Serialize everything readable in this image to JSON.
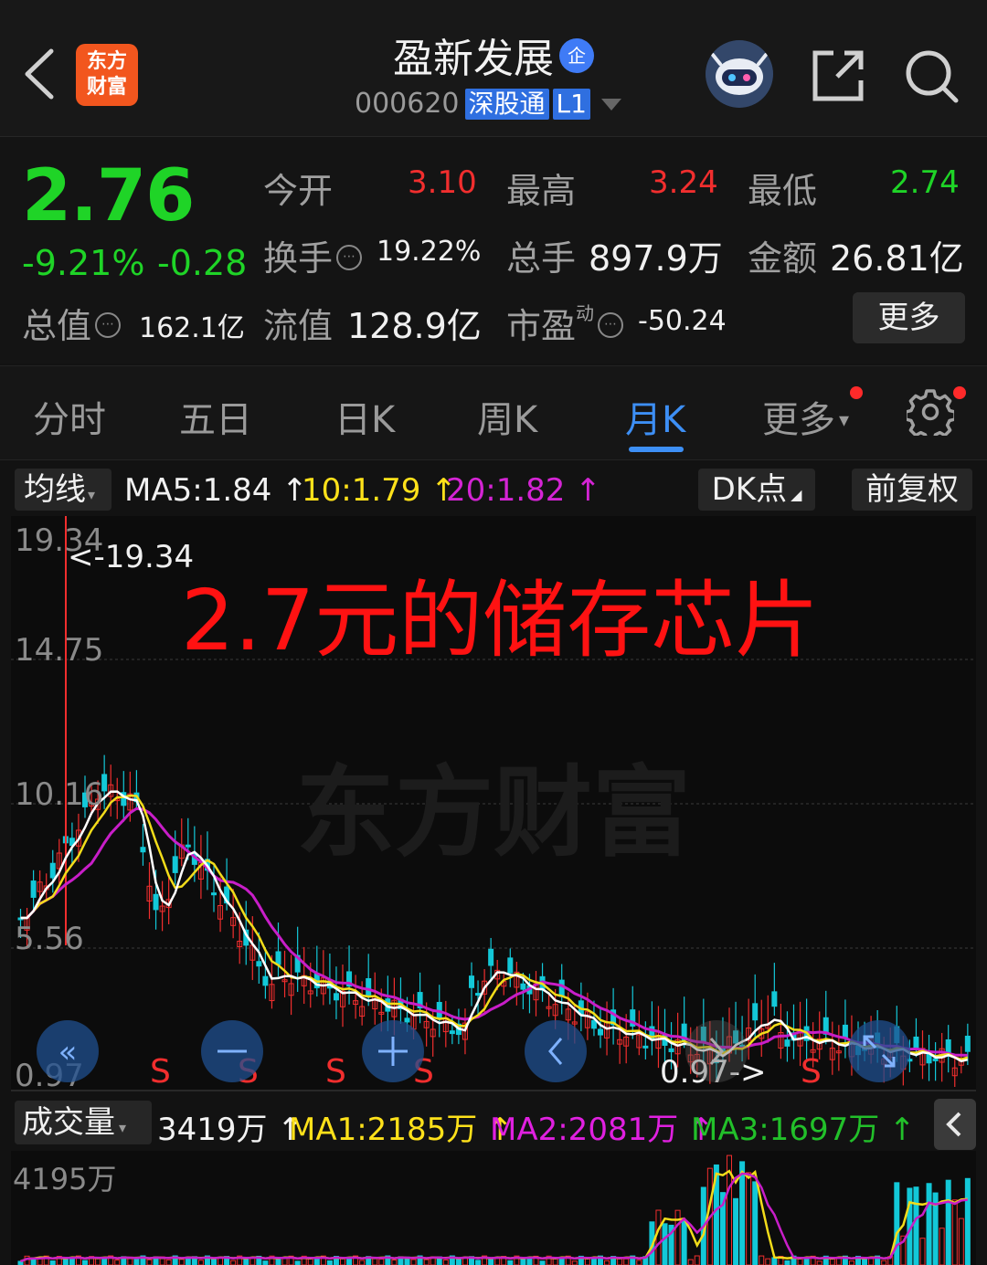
{
  "header": {
    "logo_text": "东方财富",
    "stock_name": "盈新发展",
    "stock_badge": "企",
    "code": "000620",
    "tags": [
      "深股通",
      "L1"
    ]
  },
  "quote": {
    "price": "2.76",
    "change_pct": "-9.21%",
    "change": "-0.28",
    "open_label": "今开",
    "open": "3.10",
    "high_label": "最高",
    "high": "3.24",
    "low_label": "最低",
    "low": "2.74",
    "turnover_label": "换手",
    "turnover": "19.22%",
    "volume_label": "总手",
    "volume": "897.9万",
    "amount_label": "金额",
    "amount": "26.81亿",
    "mktcap_label": "总值",
    "mktcap": "162.1亿",
    "float_label": "流值",
    "float_cap": "128.9亿",
    "pe_label": "市盈",
    "pe_sup": "动",
    "pe": "-50.24",
    "more_label": "更多"
  },
  "tabs": [
    "分时",
    "五日",
    "日K",
    "周K",
    "月K",
    "更多"
  ],
  "active_tab": 4,
  "ma_row": {
    "selector": "均线",
    "ma5": "MA5:1.84",
    "ma10": "10:1.79",
    "ma20": "20:1.82",
    "dk_button": "DK点",
    "adjust_button": "前复权"
  },
  "chart": {
    "y_ticks": [
      "19.34",
      "14.75",
      "10.16",
      "5.56",
      "0.97"
    ],
    "max_marker": "<-19.34",
    "min_marker": "0.97->",
    "overlay_title": "2.7元的储存芯片",
    "watermark": "东方财富",
    "signal_letter": "S"
  },
  "volume_row": {
    "selector": "成交量",
    "vol": "3419万",
    "ma1": "MA1:2185万",
    "ma2": "MA2:2081万",
    "ma3": "MA3:1697万",
    "y_top": "4195万"
  },
  "colors": {
    "up": "#f12e2e",
    "down": "#1fd427",
    "accent": "#3d8ff5",
    "ma5": "#ffffff",
    "ma10": "#ffe11a",
    "ma20": "#e020e0",
    "ma3": "#22c02a"
  }
}
